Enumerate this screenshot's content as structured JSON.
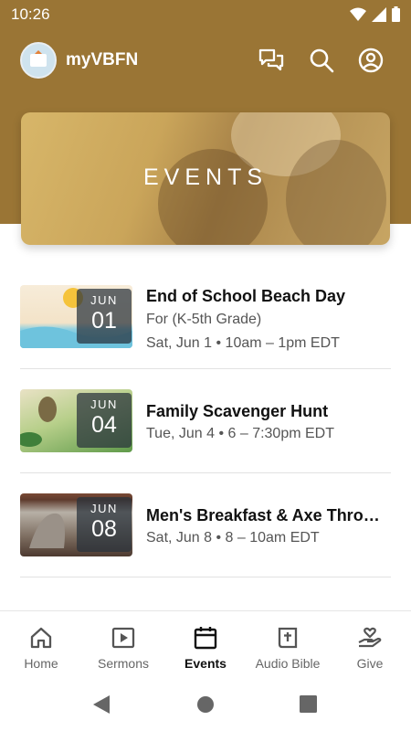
{
  "status_bar": {
    "time": "10:26"
  },
  "app_bar": {
    "title": "myVBFN"
  },
  "hero": {
    "title": "EVENTS"
  },
  "events": [
    {
      "month": "JUN",
      "day": "01",
      "title": "End of School Beach Day",
      "subtitle": "For (K-5th Grade)",
      "datetime": "Sat, Jun 1 • 10am – 1pm EDT"
    },
    {
      "month": "JUN",
      "day": "04",
      "title": "Family Scavenger Hunt",
      "datetime": "Tue, Jun 4 • 6 – 7:30pm EDT"
    },
    {
      "month": "JUN",
      "day": "08",
      "title": "Men's Breakfast & Axe Throwing",
      "datetime": "Sat, Jun 8 • 8 – 10am EDT"
    }
  ],
  "bottom_nav": [
    {
      "label": "Home",
      "icon": "home-icon"
    },
    {
      "label": "Sermons",
      "icon": "play-icon"
    },
    {
      "label": "Events",
      "icon": "calendar-icon",
      "active": true
    },
    {
      "label": "Audio Bible",
      "icon": "bible-icon"
    },
    {
      "label": "Give",
      "icon": "give-icon"
    }
  ],
  "colors": {
    "brand": "#9a7535",
    "active_text": "#111111",
    "inactive_text": "#666666"
  }
}
